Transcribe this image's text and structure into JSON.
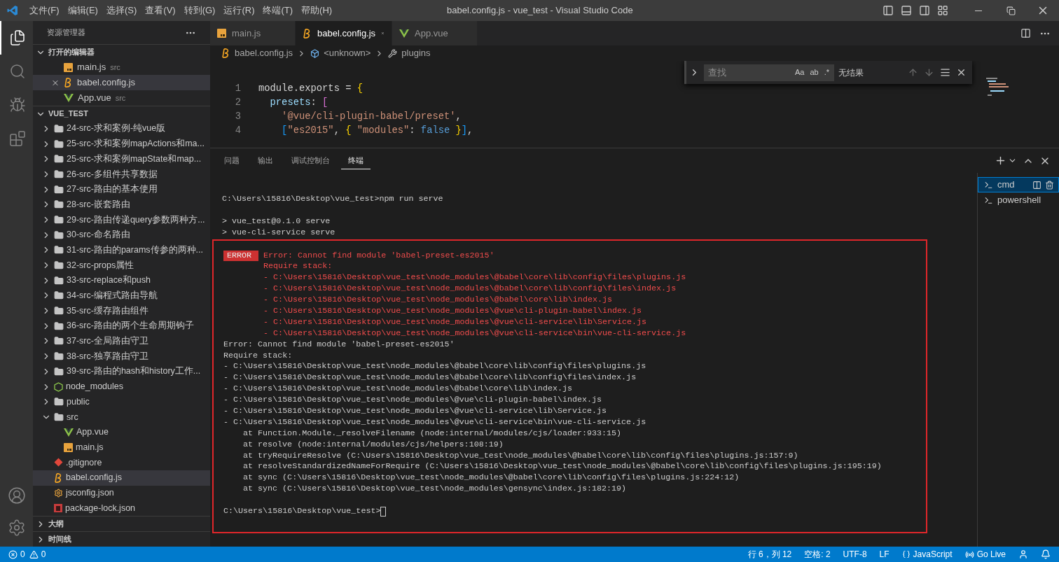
{
  "menu": [
    "文件(F)",
    "编辑(E)",
    "选择(S)",
    "查看(V)",
    "转到(G)",
    "运行(R)",
    "终端(T)",
    "帮助(H)"
  ],
  "window": {
    "title": "babel.config.js - vue_test - Visual Studio Code"
  },
  "activity_bar": [
    {
      "kind": "files",
      "selected": true
    },
    {
      "kind": "search",
      "selected": false
    },
    {
      "kind": "debug",
      "selected": false
    },
    {
      "kind": "extensions",
      "selected": false
    }
  ],
  "sidebar": {
    "title": "资源管理器",
    "sections": [
      {
        "title": "打开的编辑器",
        "expanded": true,
        "items": [
          {
            "name": "main.js",
            "hint": "src",
            "kind": "js",
            "selected": false
          },
          {
            "name": "babel.config.js",
            "kind": "babel",
            "selected": true
          },
          {
            "name": "App.vue",
            "hint": "src",
            "kind": "vue",
            "selected": false
          }
        ]
      },
      {
        "title": "VUE_TEST",
        "expanded": true,
        "tree": [
          {
            "name": "24-src-求和案例-纯vue版",
            "kind": "folder",
            "expanded": false,
            "selected": false
          },
          {
            "name": "25-src-求和案例mapActions和ma...",
            "kind": "folder",
            "expanded": false,
            "selected": false
          },
          {
            "name": "25-src-求和案例mapState和map...",
            "kind": "folder",
            "expanded": false,
            "selected": false
          },
          {
            "name": "26-src-多组件共享数据",
            "kind": "folder",
            "expanded": false,
            "selected": false
          },
          {
            "name": "27-src-路由的基本使用",
            "kind": "folder",
            "expanded": false,
            "selected": false
          },
          {
            "name": "28-src-嵌套路由",
            "kind": "folder",
            "expanded": false,
            "selected": false
          },
          {
            "name": "29-src-路由传递query参数两种方...",
            "kind": "folder",
            "expanded": false,
            "selected": false
          },
          {
            "name": "30-src-命名路由",
            "kind": "folder",
            "expanded": false,
            "selected": false
          },
          {
            "name": "31-src-路由的params传参的两种...",
            "kind": "folder",
            "expanded": false,
            "selected": false
          },
          {
            "name": "32-src-props属性",
            "kind": "folder",
            "expanded": false,
            "selected": false
          },
          {
            "name": "33-src-replace和push",
            "kind": "folder",
            "expanded": false,
            "selected": false
          },
          {
            "name": "34-src-编程式路由导航",
            "kind": "folder",
            "expanded": false,
            "selected": false
          },
          {
            "name": "35-src-缓存路由组件",
            "kind": "folder",
            "expanded": false,
            "selected": false
          },
          {
            "name": "36-src-路由的两个生命周期钩子",
            "kind": "folder",
            "expanded": false,
            "selected": false
          },
          {
            "name": "37-src-全局路由守卫",
            "kind": "folder",
            "expanded": false,
            "selected": false
          },
          {
            "name": "38-src-独享路由守卫",
            "kind": "folder",
            "expanded": false,
            "selected": false
          },
          {
            "name": "39-src-路由的hash和history工作...",
            "kind": "folder",
            "expanded": false,
            "selected": false
          },
          {
            "name": "node_modules",
            "kind": "node",
            "expanded": false,
            "selected": false
          },
          {
            "name": "public",
            "kind": "folder",
            "expanded": false,
            "selected": false
          },
          {
            "name": "src",
            "kind": "folder",
            "expanded": true,
            "selected": false,
            "children": [
              {
                "name": "App.vue",
                "kind": "vue",
                "selected": false
              },
              {
                "name": "main.js",
                "kind": "js",
                "selected": false
              }
            ]
          },
          {
            "name": ".gitignore",
            "kind": "git",
            "selected": false
          },
          {
            "name": "babel.config.js",
            "kind": "babel",
            "selected": true
          },
          {
            "name": "jsconfig.json",
            "kind": "jsconfig",
            "selected": false
          },
          {
            "name": "package-lock.json",
            "kind": "lock",
            "selected": false
          }
        ]
      },
      {
        "title": "大纲",
        "expanded": false
      },
      {
        "title": "时间线",
        "expanded": false
      }
    ]
  },
  "tabs": [
    {
      "label": "main.js",
      "kind": "js",
      "selected": false
    },
    {
      "label": "babel.config.js",
      "kind": "babel",
      "selected": true
    },
    {
      "label": "App.vue",
      "kind": "vue",
      "selected": false
    }
  ],
  "breadcrumb": [
    {
      "label": "babel.config.js",
      "kind": "babel"
    },
    {
      "label": "<unknown>",
      "kind": "symbol"
    },
    {
      "label": "plugins",
      "kind": "wrench"
    }
  ],
  "find": {
    "placeholder": "查找",
    "toggles": [
      "Aa",
      "ab",
      ".*"
    ],
    "result": "无结果"
  },
  "code": [
    {
      "number": "1",
      "tokens": [
        {
          "text": "module.exports = ",
          "kind": "plain"
        },
        {
          "text": "{",
          "kind": "bracket1"
        }
      ]
    },
    {
      "number": "2",
      "tokens": [
        {
          "text": "  presets",
          "kind": "prop"
        },
        {
          "text": ": ",
          "kind": "plain"
        },
        {
          "text": "[",
          "kind": "bracket2"
        }
      ]
    },
    {
      "number": "3",
      "tokens": [
        {
          "text": "    '@vue/cli-plugin-babel/preset'",
          "kind": "string"
        },
        {
          "text": ",",
          "kind": "plain"
        }
      ]
    },
    {
      "number": "4",
      "tokens": [
        {
          "text": "    [",
          "kind": "bracket3"
        },
        {
          "text": "\"es2015\"",
          "kind": "string"
        },
        {
          "text": ", ",
          "kind": "plain"
        },
        {
          "text": "{",
          "kind": "bracket1"
        },
        {
          "text": " \"modules\"",
          "kind": "string"
        },
        {
          "text": ": ",
          "kind": "plain"
        },
        {
          "text": "false",
          "kind": "keyword"
        },
        {
          "text": " }",
          "kind": "bracket1"
        },
        {
          "text": "]",
          "kind": "bracket3"
        },
        {
          "text": ",",
          "kind": "plain"
        }
      ]
    }
  ],
  "panel": {
    "tabs": [
      {
        "label": "问题",
        "selected": false
      },
      {
        "label": "输出",
        "selected": false
      },
      {
        "label": "调试控制台",
        "selected": false
      },
      {
        "label": "终端",
        "selected": true
      }
    ],
    "terminals": [
      {
        "name": "cmd",
        "selected": true
      },
      {
        "name": "powershell",
        "selected": false
      }
    ]
  },
  "terminal": {
    "command": "C:\\Users\\15816\\Desktop\\vue_test>npm run serve",
    "lines": [
      "> vue_test@0.1.0 serve",
      "> vue-cli-service serve"
    ],
    "error_block": {
      "badge": "ERROR",
      "lines": [
        {
          "text": "Error: Cannot find module 'babel-preset-es2015'",
          "kind": "error"
        },
        {
          "text": "Require stack:",
          "kind": "error"
        },
        {
          "text": "- C:\\Users\\15816\\Desktop\\vue_test\\node_modules\\@babel\\core\\lib\\config\\files\\plugins.js",
          "kind": "error"
        },
        {
          "text": "- C:\\Users\\15816\\Desktop\\vue_test\\node_modules\\@babel\\core\\lib\\config\\files\\index.js",
          "kind": "error"
        },
        {
          "text": "- C:\\Users\\15816\\Desktop\\vue_test\\node_modules\\@babel\\core\\lib\\index.js",
          "kind": "error"
        },
        {
          "text": "- C:\\Users\\15816\\Desktop\\vue_test\\node_modules\\@vue\\cli-plugin-babel\\index.js",
          "kind": "error"
        },
        {
          "text": "- C:\\Users\\15816\\Desktop\\vue_test\\node_modules\\@vue\\cli-service\\lib\\Service.js",
          "kind": "error"
        },
        {
          "text": "- C:\\Users\\15816\\Desktop\\vue_test\\node_modules\\@vue\\cli-service\\bin\\vue-cli-service.js",
          "kind": "error"
        },
        {
          "text": "Error: Cannot find module 'babel-preset-es2015'",
          "kind": "plain"
        },
        {
          "text": "Require stack:",
          "kind": "plain"
        },
        {
          "text": "- C:\\Users\\15816\\Desktop\\vue_test\\node_modules\\@babel\\core\\lib\\config\\files\\plugins.js",
          "kind": "plain"
        },
        {
          "text": "- C:\\Users\\15816\\Desktop\\vue_test\\node_modules\\@babel\\core\\lib\\config\\files\\index.js",
          "kind": "plain"
        },
        {
          "text": "- C:\\Users\\15816\\Desktop\\vue_test\\node_modules\\@babel\\core\\lib\\index.js",
          "kind": "plain"
        },
        {
          "text": "- C:\\Users\\15816\\Desktop\\vue_test\\node_modules\\@vue\\cli-plugin-babel\\index.js",
          "kind": "plain"
        },
        {
          "text": "- C:\\Users\\15816\\Desktop\\vue_test\\node_modules\\@vue\\cli-service\\lib\\Service.js",
          "kind": "plain"
        },
        {
          "text": "- C:\\Users\\15816\\Desktop\\vue_test\\node_modules\\@vue\\cli-service\\bin\\vue-cli-service.js",
          "kind": "plain"
        },
        {
          "text": "at Function.Module._resolveFilename (node:internal/modules/cjs/loader:933:15)",
          "kind": "trace"
        },
        {
          "text": "at resolve (node:internal/modules/cjs/helpers:108:19)",
          "kind": "trace"
        },
        {
          "text": "at tryRequireResolve (C:\\Users\\15816\\Desktop\\vue_test\\node_modules\\@babel\\core\\lib\\config\\files\\plugins.js:157:9)",
          "kind": "trace"
        },
        {
          "text": "at resolveStandardizedNameForRequire (C:\\Users\\15816\\Desktop\\vue_test\\node_modules\\@babel\\core\\lib\\config\\files\\plugins.js:195:19)",
          "kind": "trace"
        },
        {
          "text": "at sync (C:\\Users\\15816\\Desktop\\vue_test\\node_modules\\@babel\\core\\lib\\config\\files\\plugins.js:224:12)",
          "kind": "trace"
        },
        {
          "text": "at sync (C:\\Users\\15816\\Desktop\\vue_test\\node_modules\\gensync\\index.js:182:19)",
          "kind": "trace"
        }
      ],
      "prompt": "C:\\Users\\15816\\Desktop\\vue_test>"
    }
  },
  "status_bar": {
    "errors": "0",
    "warnings": "0",
    "items": [
      {
        "text": "行 6，列 12",
        "kind": "text"
      },
      {
        "text": "空格: 2",
        "kind": "text"
      },
      {
        "text": "UTF-8",
        "kind": "text"
      },
      {
        "text": "LF",
        "kind": "text"
      },
      {
        "text": "JavaScript",
        "kind": "language"
      },
      {
        "text": "Go Live",
        "kind": "live"
      }
    ]
  }
}
